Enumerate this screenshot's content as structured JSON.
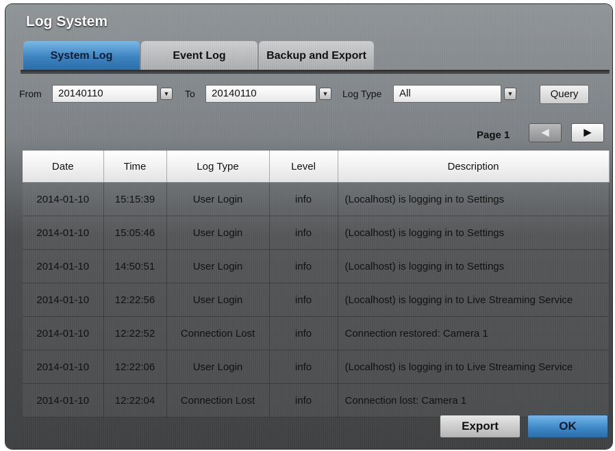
{
  "window": {
    "title": "Log System"
  },
  "tabs": [
    {
      "label": "System Log",
      "active": true
    },
    {
      "label": "Event Log",
      "active": false
    },
    {
      "label": "Backup and Export",
      "active": false
    }
  ],
  "filters": {
    "from_label": "From",
    "from_value": "20140110",
    "to_label": "To",
    "to_value": "20140110",
    "log_type_label": "Log Type",
    "log_type_value": "All",
    "query_label": "Query",
    "dropdown_icon": "triangle-down-icon"
  },
  "pager": {
    "label": "Page 1",
    "prev_icon": "triangle-left-icon",
    "next_icon": "triangle-right-icon"
  },
  "table": {
    "headers": [
      "Date",
      "Time",
      "Log Type",
      "Level",
      "Description"
    ],
    "rows": [
      [
        "2014-01-10",
        "15:15:39",
        "User Login",
        "info",
        "(Localhost) is logging in to Settings"
      ],
      [
        "2014-01-10",
        "15:05:46",
        "User Login",
        "info",
        "(Localhost) is logging in to Settings"
      ],
      [
        "2014-01-10",
        "14:50:51",
        "User Login",
        "info",
        "(Localhost) is logging in to Settings"
      ],
      [
        "2014-01-10",
        "12:22:56",
        "User Login",
        "info",
        "(Localhost) is logging in to Live Streaming Service"
      ],
      [
        "2014-01-10",
        "12:22:52",
        "Connection Lost",
        "info",
        "Connection restored: Camera 1"
      ],
      [
        "2014-01-10",
        "12:22:06",
        "User Login",
        "info",
        "(Localhost) is logging in to Live Streaming Service"
      ],
      [
        "2014-01-10",
        "12:22:04",
        "Connection Lost",
        "info",
        "Connection lost: Camera 1"
      ]
    ]
  },
  "footer": {
    "export_label": "Export",
    "ok_label": "OK"
  },
  "colors": {
    "accent": "#3d84c1",
    "background": "#6b6f72"
  }
}
